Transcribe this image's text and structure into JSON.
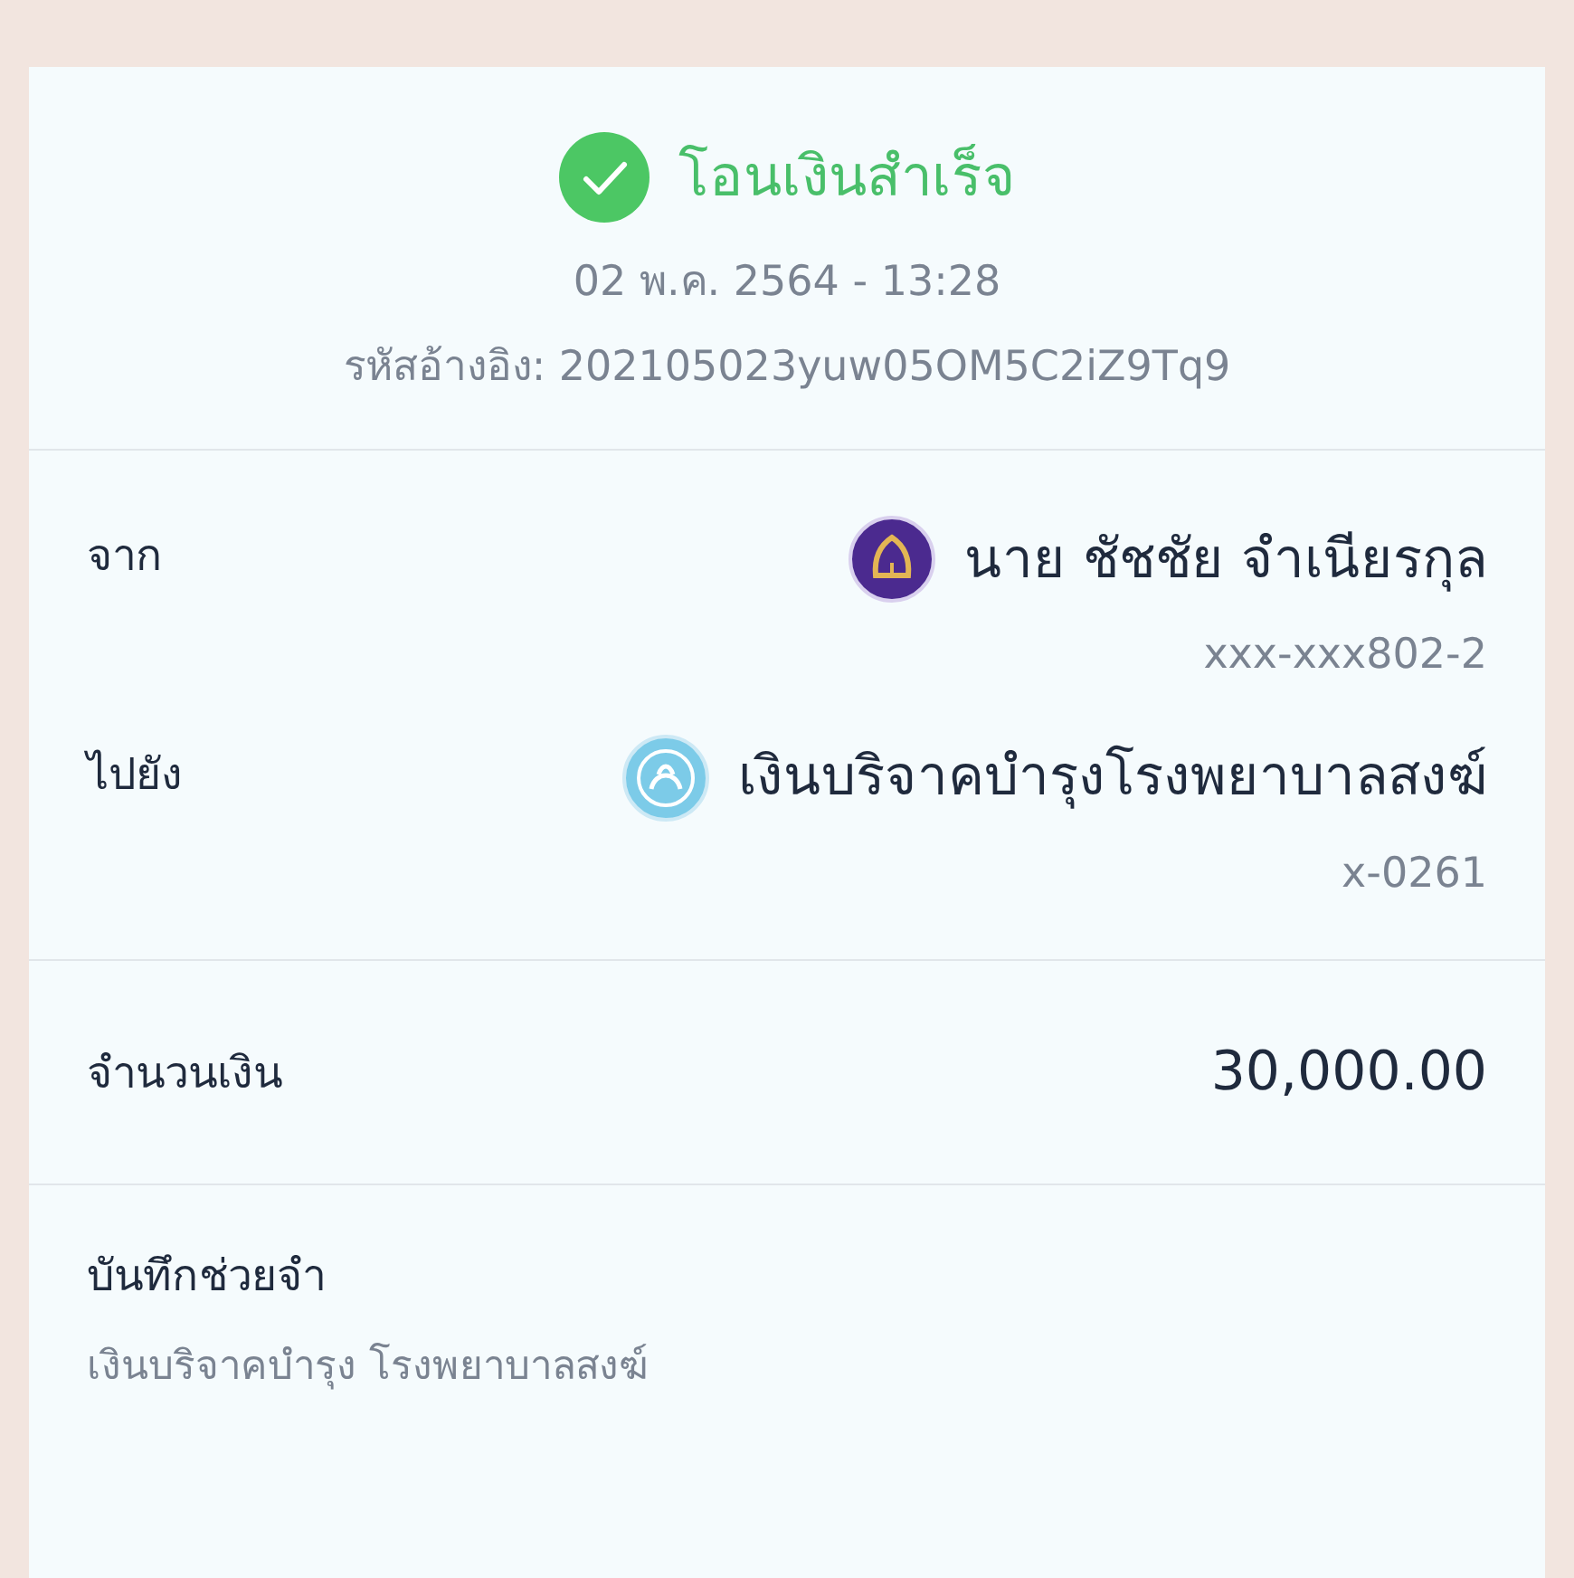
{
  "status": {
    "title": "โอนเงินสำเร็จ",
    "datetime": "02 พ.ค. 2564 - 13:28",
    "reference": "รหัสอ้างอิง: 202105023yuw05OM5C2iZ9Tq9"
  },
  "parties": [
    {
      "label": "จาก",
      "kind": "purple-bank",
      "name": "นาย ชัชชัย จำเนียรกุล",
      "account": "xxx-xxx802-2"
    },
    {
      "label": "ไปยัง",
      "kind": "blue-bank",
      "name": "เงินบริจาคบำรุงโรงพยาบาลสงฆ์",
      "account": "x-0261"
    }
  ],
  "amount": {
    "label": "จำนวนเงิน",
    "value": "30,000.00"
  },
  "memo": {
    "label": "บันทึกช่วยจำ",
    "text": "เงินบริจาคบำรุง โรงพยาบาลสงฆ์"
  }
}
